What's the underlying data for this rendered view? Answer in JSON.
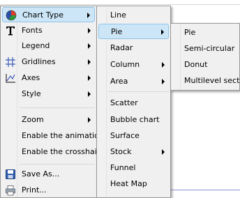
{
  "main_menu": {
    "items": [
      {
        "label": "Chart Type",
        "icon": "chart-type-icon"
      },
      {
        "label": "Fonts",
        "icon": "font-t-icon"
      },
      {
        "label": "Legend"
      },
      {
        "label": "Gridlines",
        "icon": "gridlines-icon"
      },
      {
        "label": "Axes",
        "icon": "axes-icon"
      },
      {
        "label": "Style"
      },
      {
        "label": "Zoom"
      },
      {
        "label": "Enable the animations"
      },
      {
        "label": "Enable the crosshairs"
      },
      {
        "label": "Save As...",
        "icon": "save-disk-icon"
      },
      {
        "label": "Print...",
        "icon": "printer-icon"
      }
    ]
  },
  "chart_type_menu": {
    "items": [
      {
        "label": "Line"
      },
      {
        "label": "Pie"
      },
      {
        "label": "Radar"
      },
      {
        "label": "Column"
      },
      {
        "label": "Area"
      },
      {
        "label": "Scatter"
      },
      {
        "label": "Bubble chart"
      },
      {
        "label": "Surface"
      },
      {
        "label": "Stock"
      },
      {
        "label": "Funnel"
      },
      {
        "label": "Heat Map"
      }
    ]
  },
  "pie_menu": {
    "items": [
      {
        "label": "Pie"
      },
      {
        "label": "Semi-circular"
      },
      {
        "label": "Donut"
      },
      {
        "label": "Multilevel sector"
      }
    ]
  },
  "colors": {
    "menu_background": "#f0f0f0",
    "highlight_fill": "#cde6f7",
    "highlight_border": "#8fc3e8",
    "separator": "#d7d7d7"
  }
}
